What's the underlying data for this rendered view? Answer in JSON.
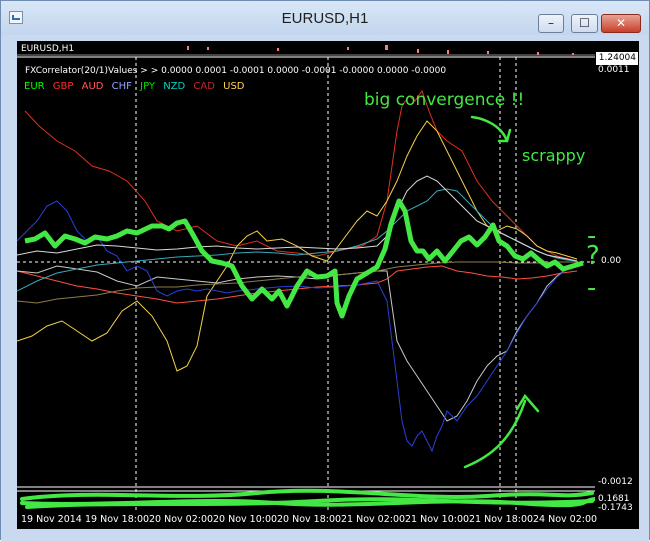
{
  "window": {
    "title": "EURUSD,H1"
  },
  "window_buttons": {
    "minimize": "–",
    "maximize": "☐",
    "close": "✕"
  },
  "chart": {
    "symbol": "EURUSD,H1",
    "price": "1.24004",
    "indicator_line": "FXCorrelator(20/1)Values > > 0.0000 0.0001 -0.0001 0.0000 -0.0001 -0.0000 0.0000 -0.0000",
    "legend": [
      {
        "name": "EUR",
        "color": "#00ff00"
      },
      {
        "name": "GBP",
        "color": "#ff2a2a"
      },
      {
        "name": "AUD",
        "color": "#ff5a5a"
      },
      {
        "name": "CHF",
        "color": "#9aa0ff"
      },
      {
        "name": "JPY",
        "color": "#00e000"
      },
      {
        "name": "NZD",
        "color": "#00d0c0"
      },
      {
        "name": "CAD",
        "color": "#c0282a"
      },
      {
        "name": "USD",
        "color": "#ffd54a"
      }
    ],
    "axis_values": {
      "top": "0.0011",
      "zero": "0.00",
      "bottom": "-0.0012",
      "sub_a": "0.1681",
      "sub_b": "-0.1743"
    },
    "time_labels": [
      "19 Nov 2014",
      "19 Nov 18:00",
      "20 Nov 02:00",
      "20 Nov 10:00",
      "20 Nov 18:00",
      "21 Nov 02:00",
      "21 Nov 10:00",
      "21 Nov 18:00",
      "24 Nov 02:00"
    ],
    "annotations": {
      "big": "big convergence !!",
      "scrappy": "scrappy",
      "question": "?"
    },
    "colors": {
      "background": "#000000",
      "annotation": "#44e844"
    }
  }
}
